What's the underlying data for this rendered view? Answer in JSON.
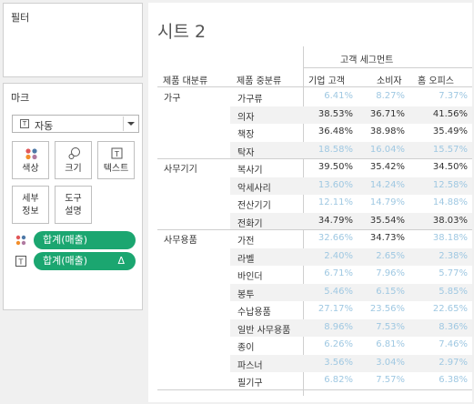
{
  "filters": {
    "title": "필터"
  },
  "marks": {
    "title": "마크",
    "mark_type": "자동",
    "buttons": [
      {
        "id": "color",
        "label": "색상",
        "icon": "color-dots-icon"
      },
      {
        "id": "size",
        "label": "크기",
        "icon": "size-icon"
      },
      {
        "id": "text",
        "label": "텍스트",
        "icon": "text-icon"
      },
      {
        "id": "detail",
        "label": "세부\n정보"
      },
      {
        "id": "tooltip",
        "label": "도구\n설명"
      }
    ],
    "pills": [
      {
        "label": "합계(매출)",
        "lead_icon": "color-dots-icon",
        "delta": ""
      },
      {
        "label": "합계(매출)",
        "lead_icon": "text-icon",
        "delta": "Δ"
      }
    ]
  },
  "sheet": {
    "title": "시트 2",
    "column_group_header": "고객 세그먼트",
    "row_headers": [
      "제품 대분류",
      "제품 중분류"
    ],
    "column_headers": [
      "기업 고객",
      "소비자",
      "홈 오피스"
    ],
    "groups": [
      {
        "category": "가구",
        "rows": [
          {
            "sub": "가구류",
            "values": [
              "6.41%",
              "8.27%",
              "7.37%"
            ],
            "tone": [
              "low",
              "low",
              "low"
            ]
          },
          {
            "sub": "의자",
            "values": [
              "38.53%",
              "36.71%",
              "41.56%"
            ],
            "tone": [
              "high",
              "high",
              "high"
            ]
          },
          {
            "sub": "책장",
            "values": [
              "36.48%",
              "38.98%",
              "35.49%"
            ],
            "tone": [
              "high",
              "high",
              "high"
            ]
          },
          {
            "sub": "탁자",
            "values": [
              "18.58%",
              "16.04%",
              "15.57%"
            ],
            "tone": [
              "low",
              "low",
              "low"
            ]
          }
        ]
      },
      {
        "category": "사무기기",
        "rows": [
          {
            "sub": "복사기",
            "values": [
              "39.50%",
              "35.42%",
              "34.50%"
            ],
            "tone": [
              "high",
              "high",
              "high"
            ]
          },
          {
            "sub": "악세사리",
            "values": [
              "13.60%",
              "14.24%",
              "12.58%"
            ],
            "tone": [
              "low",
              "low",
              "low"
            ]
          },
          {
            "sub": "전산기기",
            "values": [
              "12.11%",
              "14.79%",
              "14.88%"
            ],
            "tone": [
              "low",
              "low",
              "low"
            ]
          },
          {
            "sub": "전화기",
            "values": [
              "34.79%",
              "35.54%",
              "38.03%"
            ],
            "tone": [
              "high",
              "high",
              "high"
            ]
          }
        ]
      },
      {
        "category": "사무용품",
        "rows": [
          {
            "sub": "가전",
            "values": [
              "32.66%",
              "34.73%",
              "38.18%"
            ],
            "tone": [
              "low",
              "high",
              "low"
            ]
          },
          {
            "sub": "라벨",
            "values": [
              "2.40%",
              "2.65%",
              "2.38%"
            ],
            "tone": [
              "low",
              "low",
              "low"
            ]
          },
          {
            "sub": "바인더",
            "values": [
              "6.71%",
              "7.96%",
              "5.77%"
            ],
            "tone": [
              "low",
              "low",
              "low"
            ]
          },
          {
            "sub": "봉투",
            "values": [
              "5.46%",
              "6.15%",
              "5.85%"
            ],
            "tone": [
              "low",
              "low",
              "low"
            ]
          },
          {
            "sub": "수납용품",
            "values": [
              "27.17%",
              "23.56%",
              "22.65%"
            ],
            "tone": [
              "low",
              "low",
              "low"
            ]
          },
          {
            "sub": "일반 사무용품",
            "values": [
              "8.96%",
              "7.53%",
              "8.36%"
            ],
            "tone": [
              "low",
              "low",
              "low"
            ]
          },
          {
            "sub": "종이",
            "values": [
              "6.26%",
              "6.81%",
              "7.46%"
            ],
            "tone": [
              "low",
              "low",
              "low"
            ]
          },
          {
            "sub": "파스너",
            "values": [
              "3.56%",
              "3.04%",
              "2.97%"
            ],
            "tone": [
              "low",
              "low",
              "low"
            ]
          },
          {
            "sub": "필기구",
            "values": [
              "6.82%",
              "7.57%",
              "6.38%"
            ],
            "tone": [
              "low",
              "low",
              "low"
            ]
          }
        ]
      }
    ]
  },
  "colors": {
    "pill_green": "#1ba670",
    "value_dark": "#333333",
    "value_light": "#9fc8e2",
    "row_band": "#f2f2f2"
  }
}
